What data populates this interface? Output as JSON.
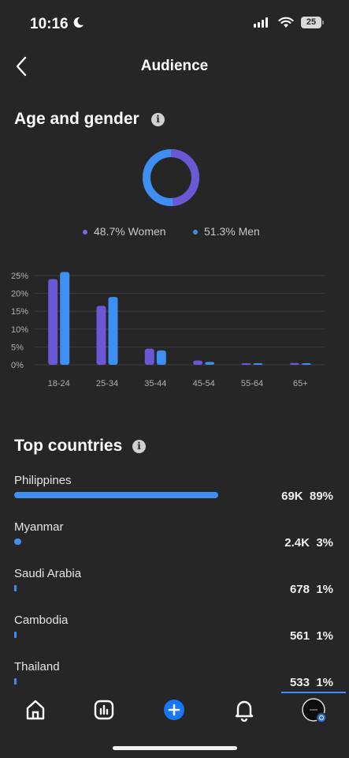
{
  "status_bar": {
    "time": "10:16",
    "battery": "25"
  },
  "header": {
    "title": "Audience"
  },
  "age_gender": {
    "title": "Age and gender",
    "women": {
      "label": "48.7% Women",
      "value": 48.7,
      "color": "#6a58d6"
    },
    "men": {
      "label": "51.3% Men",
      "value": 51.3,
      "color": "#3f8ef1"
    },
    "chart_data": {
      "type": "bar",
      "categories": [
        "18-24",
        "25-34",
        "35-44",
        "45-54",
        "55-64",
        "65+"
      ],
      "series": [
        {
          "values": [
            24,
            16.5,
            4.5,
            1.2,
            0.4,
            0.5
          ]
        },
        {
          "values": [
            26,
            19,
            4,
            0.8,
            0.3,
            0.4
          ]
        }
      ],
      "ylim": [
        0,
        25
      ],
      "yticks": [
        "25%",
        "20%",
        "15%",
        "10%",
        "5%",
        "0%"
      ],
      "colors": [
        "#6a58d6",
        "#3f8ef1"
      ]
    }
  },
  "countries": {
    "title": "Top countries",
    "items": [
      {
        "name": "Philippines",
        "count": "69K",
        "percent": "89%",
        "fraction": 0.89
      },
      {
        "name": "Myanmar",
        "count": "2.4K",
        "percent": "3%",
        "fraction": 0.03
      },
      {
        "name": "Saudi Arabia",
        "count": "678",
        "percent": "1%",
        "fraction": 0.01
      },
      {
        "name": "Cambodia",
        "count": "561",
        "percent": "1%",
        "fraction": 0.01
      },
      {
        "name": "Thailand",
        "count": "533",
        "percent": "1%",
        "fraction": 0.01
      }
    ]
  },
  "tab_bar": {
    "items": [
      "home-icon",
      "analytics-icon",
      "create-icon",
      "notifications-icon",
      "profile-avatar"
    ]
  }
}
